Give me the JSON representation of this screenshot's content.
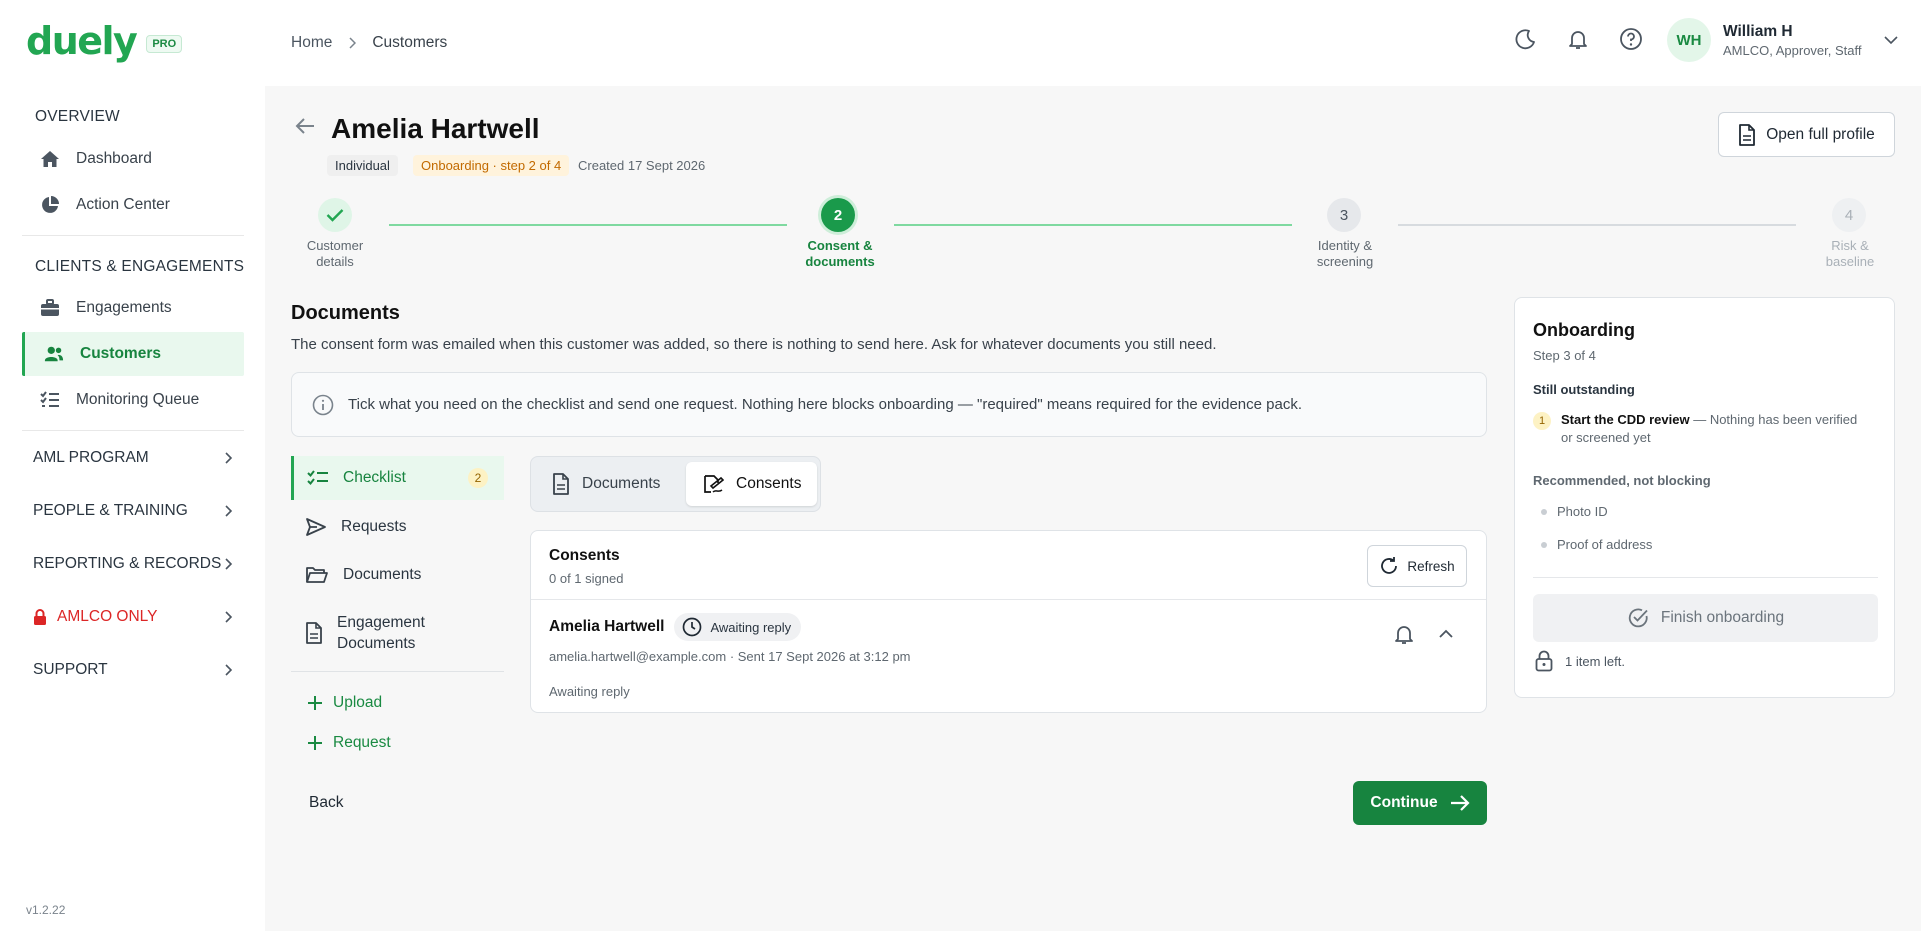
{
  "app": {
    "logo": "duely",
    "badge": "PRO",
    "version": "v1.2.22"
  },
  "sidebar": {
    "sections": [
      {
        "label": "OVERVIEW",
        "items": [
          {
            "label": "Dashboard",
            "icon": "home-icon"
          },
          {
            "label": "Action Center",
            "icon": "pie-chart-icon"
          }
        ]
      },
      {
        "label": "CLIENTS & ENGAGEMENTS",
        "items": [
          {
            "label": "Engagements",
            "icon": "briefcase-icon"
          },
          {
            "label": "Customers",
            "icon": "users-icon",
            "active": true
          },
          {
            "label": "Monitoring Queue",
            "icon": "list-check-icon"
          }
        ]
      }
    ],
    "groups": [
      "AML PROGRAM",
      "PEOPLE & TRAINING",
      "REPORTING & RECORDS",
      "AMLCO ONLY",
      "SUPPORT"
    ]
  },
  "breadcrumb": {
    "home": "Home",
    "current": "Customers"
  },
  "user": {
    "initials": "WH",
    "name": "William H",
    "roles": "AMLCO, Approver, Staff"
  },
  "customer": {
    "name": "Amelia Hartwell",
    "type_tag": "Individual",
    "status_tag": "Onboarding · step 2 of 4",
    "created": "Created 17 Sept 2026",
    "open_profile": "Open full profile"
  },
  "stepper": {
    "steps": [
      {
        "number": "1",
        "label_line1": "Customer",
        "label_line2": "details",
        "state": "done"
      },
      {
        "number": "2",
        "label_line1": "Consent &",
        "label_line2": "documents",
        "state": "current"
      },
      {
        "number": "3",
        "label_line1": "Identity &",
        "label_line2": "screening",
        "state": "upcoming"
      },
      {
        "number": "4",
        "label_line1": "Risk &",
        "label_line2": "baseline",
        "state": "disabled"
      }
    ]
  },
  "documents": {
    "heading": "Documents",
    "description": "The consent form was emailed when this customer was added, so there is nothing to send here. Ask for whatever documents you still need.",
    "info": "Tick what you need on the checklist and send one request. Nothing here blocks onboarding — \"required\" means required for the evidence pack.",
    "side_tabs": {
      "checklist": "Checklist",
      "checklist_count": "2",
      "requests": "Requests",
      "documents": "Documents",
      "engagement_line1": "Engagement",
      "engagement_line2": "Documents"
    },
    "actions": {
      "upload": "Upload",
      "request": "Request"
    },
    "segments": {
      "documents": "Documents",
      "consents": "Consents"
    },
    "consents_card": {
      "title": "Consents",
      "subtitle": "0 of 1 signed",
      "refresh": "Refresh",
      "row": {
        "name": "Amelia Hartwell",
        "status": "Awaiting reply",
        "meta": "amelia.hartwell@example.com · Sent 17 Sept 2026 at 3:12 pm",
        "note": "Awaiting reply"
      }
    },
    "back": "Back",
    "continue": "Continue"
  },
  "onboarding_panel": {
    "title": "Onboarding",
    "step": "Step 3 of 4",
    "outstanding_heading": "Still outstanding",
    "outstanding": [
      {
        "number": "1",
        "title": "Start the CDD review",
        "detail_line1": " — Nothing has been verified",
        "detail_line2": "or screened yet"
      }
    ],
    "recommended_heading": "Recommended, not blocking",
    "recommended": [
      "Photo ID",
      "Proof of address"
    ],
    "finish": "Finish onboarding",
    "remaining": "1 item left."
  },
  "colors": {
    "accent": "#22a652",
    "accent_dark": "#17843f",
    "danger": "#dc2626",
    "warning": "#c26a00"
  }
}
